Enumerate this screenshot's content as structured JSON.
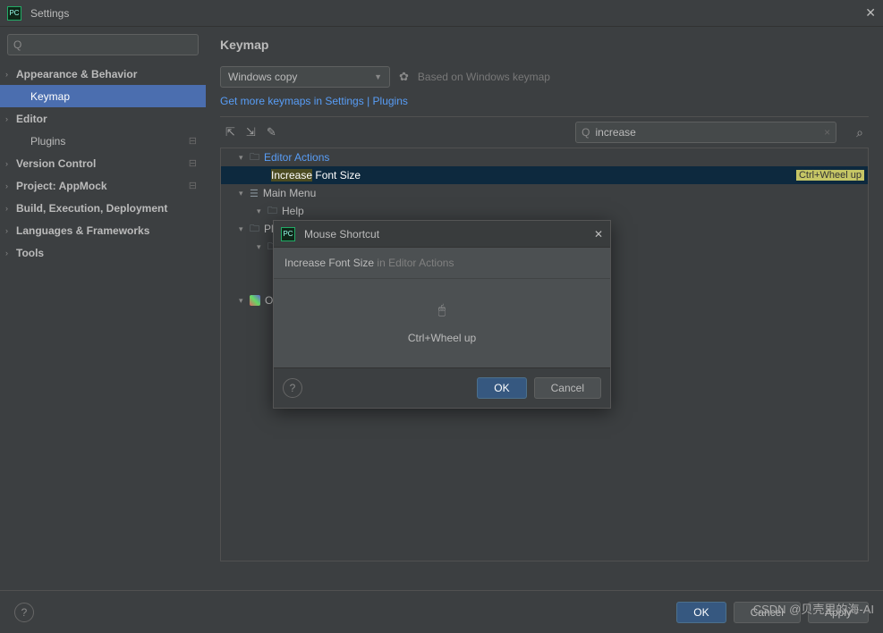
{
  "window": {
    "title": "Settings"
  },
  "sidebar": {
    "search_placeholder": "",
    "items": [
      {
        "label": "Appearance & Behavior",
        "bold": true,
        "chev": true,
        "indent": false
      },
      {
        "label": "Keymap",
        "bold": false,
        "chev": false,
        "indent": true,
        "selected": true
      },
      {
        "label": "Editor",
        "bold": true,
        "chev": true,
        "indent": false
      },
      {
        "label": "Plugins",
        "bold": false,
        "chev": false,
        "indent": true,
        "cog": true
      },
      {
        "label": "Version Control",
        "bold": true,
        "chev": true,
        "indent": false,
        "cog": true
      },
      {
        "label": "Project: AppMock",
        "bold": true,
        "chev": true,
        "indent": false,
        "cog": true
      },
      {
        "label": "Build, Execution, Deployment",
        "bold": true,
        "chev": true,
        "indent": false
      },
      {
        "label": "Languages & Frameworks",
        "bold": true,
        "chev": true,
        "indent": false
      },
      {
        "label": "Tools",
        "bold": true,
        "chev": true,
        "indent": false
      }
    ]
  },
  "content": {
    "page_title": "Keymap",
    "profile": "Windows copy",
    "based_on": "Based on Windows keymap",
    "link_text_a": "Get more keymaps in Settings | Plugins",
    "search_value": "increase",
    "tree": {
      "editor_actions": "Editor Actions",
      "increase": "Increase",
      "font_size": " Font Size",
      "shortcut": "Ctrl+Wheel up",
      "main_menu": "Main Menu",
      "help": "Help",
      "plu": "Plu",
      "other": "Ot"
    }
  },
  "dialog": {
    "title": "Mouse Shortcut",
    "action": "Increase Font Size",
    "context": " in Editor Actions",
    "shortcut": "Ctrl+Wheel up",
    "ok": "OK",
    "cancel": "Cancel"
  },
  "footer": {
    "ok": "OK",
    "cancel": "Cancel",
    "apply": "Apply"
  },
  "watermark": "CSDN @贝壳里的海-AI"
}
